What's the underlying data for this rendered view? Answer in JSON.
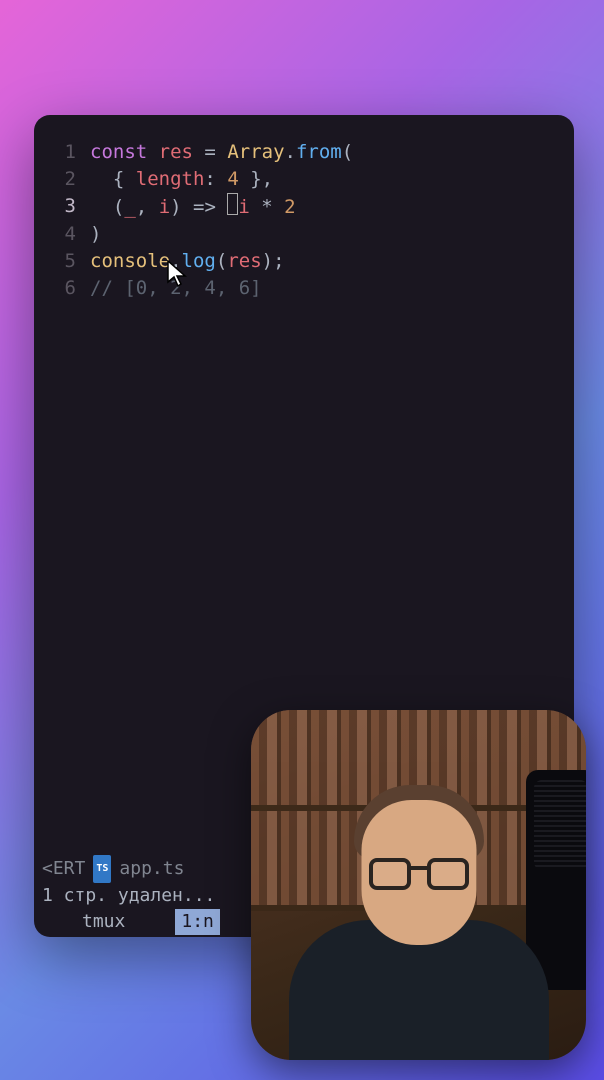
{
  "code": {
    "lines": [
      {
        "num": "1",
        "active": false
      },
      {
        "num": "2",
        "active": false
      },
      {
        "num": "3",
        "active": true
      },
      {
        "num": "4",
        "active": false
      },
      {
        "num": "5",
        "active": false
      },
      {
        "num": "6",
        "active": false
      }
    ],
    "tokens": {
      "const": "const",
      "res": "res",
      "eq": " = ",
      "array": "Array",
      "dot1": ".",
      "from": "from",
      "lparen1": "(",
      "indent2": "  ",
      "lbrace": "{ ",
      "length": "length",
      "colon": ": ",
      "four": "4",
      "rbrace": " }",
      "comma1": ",",
      "indent3": "  ",
      "lparen2": "(",
      "underscore": "_",
      "comma2": ", ",
      "i_param": "i",
      "rparen2": ")",
      "arrow": " => ",
      "i_use": "i",
      "mul": " * ",
      "two": "2",
      "rparen_close": ")",
      "console": "console",
      "dot2": ".",
      "log": "log",
      "lparen3": "(",
      "res_use": "res",
      "rparen3": ")",
      "semi": ";",
      "comment": "// [0, 2, 4, 6]"
    }
  },
  "status": {
    "mode": "<ERT",
    "ts_badge": "TS",
    "filename": "app.ts",
    "message": "1 стр. удален...",
    "tmux_label": "tmux",
    "tmux_session": "1:n"
  },
  "webcam": {
    "description": "person-with-glasses"
  }
}
